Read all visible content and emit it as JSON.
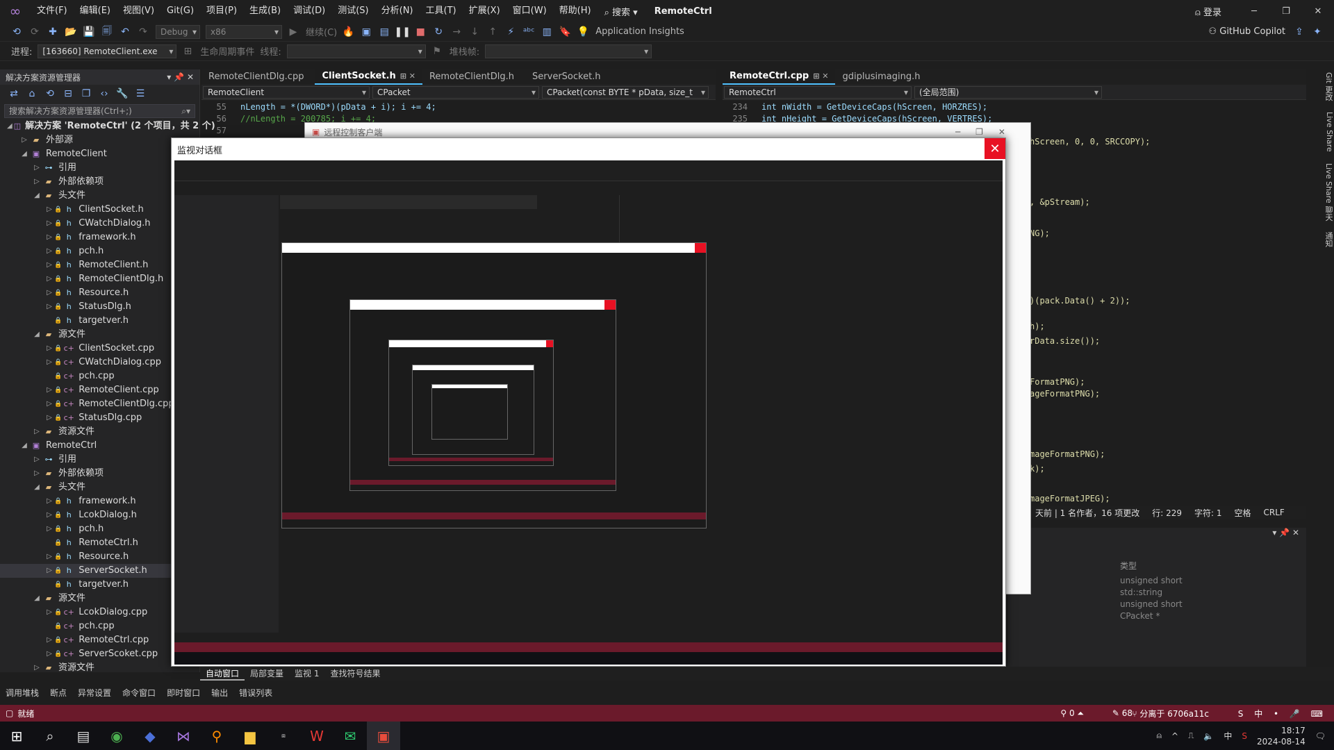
{
  "menubar": {
    "items": [
      "文件(F)",
      "编辑(E)",
      "视图(V)",
      "Git(G)",
      "项目(P)",
      "生成(B)",
      "调试(D)",
      "测试(S)",
      "分析(N)",
      "工具(T)",
      "扩展(X)",
      "窗口(W)",
      "帮助(H)"
    ],
    "search": "搜索",
    "title": "RemoteCtrl",
    "login": "登录"
  },
  "toolbar": {
    "config": "Debug",
    "platform": "x86",
    "continue": "继续(C)",
    "app_insights": "Application Insights",
    "copilot": "GitHub Copilot"
  },
  "debugbar": {
    "process_label": "进程:",
    "process_value": "[163660] RemoteClient.exe",
    "lifecycle_label": "生命周期事件",
    "thread_label": "线程:",
    "stack_label": "堆栈帧:"
  },
  "solution_explorer": {
    "title": "解决方案资源管理器",
    "search_placeholder": "搜索解决方案资源管理器(Ctrl+;)",
    "items": [
      {
        "label": "解决方案 'RemoteCtrl' (2 个项目，共 2 个)",
        "indent": 0,
        "icon": "solution",
        "exp": "◢"
      },
      {
        "label": "外部源",
        "indent": 1,
        "icon": "folder",
        "exp": "▷"
      },
      {
        "label": "RemoteClient",
        "indent": 1,
        "icon": "proj",
        "exp": "◢"
      },
      {
        "label": "引用",
        "indent": 2,
        "icon": "ref",
        "exp": "▷"
      },
      {
        "label": "外部依赖项",
        "indent": 2,
        "icon": "folder",
        "exp": "▷"
      },
      {
        "label": "头文件",
        "indent": 2,
        "icon": "folder",
        "exp": "◢"
      },
      {
        "label": "ClientSocket.h",
        "indent": 3,
        "icon": "h",
        "exp": "▷"
      },
      {
        "label": "CWatchDialog.h",
        "indent": 3,
        "icon": "h",
        "exp": "▷"
      },
      {
        "label": "framework.h",
        "indent": 3,
        "icon": "h",
        "exp": "▷"
      },
      {
        "label": "pch.h",
        "indent": 3,
        "icon": "h",
        "exp": "▷"
      },
      {
        "label": "RemoteClient.h",
        "indent": 3,
        "icon": "h",
        "exp": "▷"
      },
      {
        "label": "RemoteClientDlg.h",
        "indent": 3,
        "icon": "h",
        "exp": "▷"
      },
      {
        "label": "Resource.h",
        "indent": 3,
        "icon": "h",
        "exp": "▷"
      },
      {
        "label": "StatusDlg.h",
        "indent": 3,
        "icon": "h",
        "exp": "▷"
      },
      {
        "label": "targetver.h",
        "indent": 3,
        "icon": "h",
        "exp": ""
      },
      {
        "label": "源文件",
        "indent": 2,
        "icon": "folder",
        "exp": "◢"
      },
      {
        "label": "ClientSocket.cpp",
        "indent": 3,
        "icon": "cpp",
        "exp": "▷"
      },
      {
        "label": "CWatchDialog.cpp",
        "indent": 3,
        "icon": "cpp",
        "exp": "▷"
      },
      {
        "label": "pch.cpp",
        "indent": 3,
        "icon": "cpp",
        "exp": ""
      },
      {
        "label": "RemoteClient.cpp",
        "indent": 3,
        "icon": "cpp",
        "exp": "▷"
      },
      {
        "label": "RemoteClientDlg.cpp",
        "indent": 3,
        "icon": "cpp",
        "exp": "▷"
      },
      {
        "label": "StatusDlg.cpp",
        "indent": 3,
        "icon": "cpp",
        "exp": "▷"
      },
      {
        "label": "资源文件",
        "indent": 2,
        "icon": "folder",
        "exp": "▷"
      },
      {
        "label": "RemoteCtrl",
        "indent": 1,
        "icon": "proj",
        "exp": "◢"
      },
      {
        "label": "引用",
        "indent": 2,
        "icon": "ref",
        "exp": "▷"
      },
      {
        "label": "外部依赖项",
        "indent": 2,
        "icon": "folder",
        "exp": "▷"
      },
      {
        "label": "头文件",
        "indent": 2,
        "icon": "folder",
        "exp": "◢"
      },
      {
        "label": "framework.h",
        "indent": 3,
        "icon": "h",
        "exp": "▷"
      },
      {
        "label": "LcokDialog.h",
        "indent": 3,
        "icon": "h",
        "exp": "▷"
      },
      {
        "label": "pch.h",
        "indent": 3,
        "icon": "h",
        "exp": "▷"
      },
      {
        "label": "RemoteCtrl.h",
        "indent": 3,
        "icon": "h",
        "exp": ""
      },
      {
        "label": "Resource.h",
        "indent": 3,
        "icon": "h",
        "exp": "▷"
      },
      {
        "label": "ServerSocket.h",
        "indent": 3,
        "icon": "h",
        "exp": "▷",
        "selected": true
      },
      {
        "label": "targetver.h",
        "indent": 3,
        "icon": "h",
        "exp": ""
      },
      {
        "label": "源文件",
        "indent": 2,
        "icon": "folder",
        "exp": "◢"
      },
      {
        "label": "LcokDialog.cpp",
        "indent": 3,
        "icon": "cpp",
        "exp": "▷"
      },
      {
        "label": "pch.cpp",
        "indent": 3,
        "icon": "cpp",
        "exp": ""
      },
      {
        "label": "RemoteCtrl.cpp",
        "indent": 3,
        "icon": "cpp",
        "exp": "▷"
      },
      {
        "label": "ServerScoket.cpp",
        "indent": 3,
        "icon": "cpp",
        "exp": "▷"
      },
      {
        "label": "资源文件",
        "indent": 2,
        "icon": "folder",
        "exp": "▷"
      }
    ]
  },
  "editor_left": {
    "tabs": [
      "RemoteClientDlg.cpp",
      "ClientSocket.h",
      "RemoteClientDlg.h",
      "ServerSocket.h"
    ],
    "active_tab": 1,
    "nav": [
      "RemoteClient",
      "CPacket",
      "CPacket(const BYTE * pData, size_t"
    ],
    "lines": [
      {
        "n": "55",
        "code": "nLength = *(DWORD*)(pData + i); i += 4;"
      },
      {
        "n": "56",
        "code": "//nLength = 200785; i += 4;"
      },
      {
        "n": "57",
        "code": ""
      }
    ]
  },
  "editor_right": {
    "tabs": [
      "RemoteCtrl.cpp",
      "gdiplusimaging.h"
    ],
    "nav": [
      "RemoteCtrl",
      "(全局范围)"
    ],
    "lines": [
      {
        "n": "234",
        "code": "int nWidth = GetDeviceCaps(hScreen, HORZRES);"
      },
      {
        "n": "235",
        "code": "int nHeight = GetDeviceCaps(hScreen, VERTRES);"
      }
    ],
    "fragments": [
      "hScreen, 0, 0, SRCCOPY);",
      ", &pStream);",
      "NG);",
      ")(pack.Data() + 2));",
      "h);",
      "rData.size());",
      "FormatPNG);",
      "ageFormatPNG);",
      "mageFormatPNG);",
      "k);",
      "mageFormatJPEG);",
      "k);"
    ],
    "status": "天前 | 1 名作者，16 项更改",
    "line_col": "行: 229",
    "char": "字符: 1",
    "space": "空格",
    "eol": "CRLF"
  },
  "watch_panel": {
    "type_header": "类型",
    "types": [
      "unsigned short",
      "std::string",
      "unsigned short",
      "CPacket *"
    ]
  },
  "remote_dialog": {
    "client_title": "远程控制客户端",
    "watch_title": "监视对话框"
  },
  "bottom_tabs": [
    "自动窗口",
    "局部变量",
    "监视 1",
    "查找符号结果"
  ],
  "bottom_tabs2": [
    "调用堆栈",
    "断点",
    "异常设置",
    "命令窗口",
    "即时窗口",
    "输出",
    "错误列表"
  ],
  "statusbar": {
    "ready": "就绪",
    "errors": "0",
    "changes": "68",
    "branch": "分离于 6706a11c"
  },
  "taskbar": {
    "time": "18:17",
    "date": "2024-08-14",
    "lang": "中"
  },
  "side_tabs": [
    "Git 更改",
    "Live Share",
    "Live Share 聊天",
    "通知"
  ]
}
